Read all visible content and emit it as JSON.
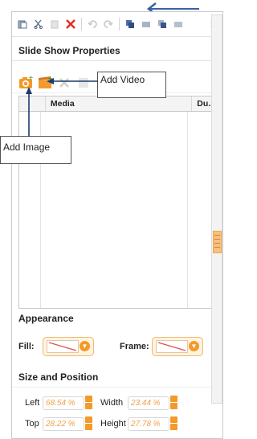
{
  "panel": {
    "title": "Slide Show Properties",
    "collapse_glyph": "»"
  },
  "table": {
    "columns": [
      "Media",
      "Du..."
    ]
  },
  "appearance": {
    "heading": "Appearance",
    "fill_label": "Fill:",
    "frame_label": "Frame:"
  },
  "size_position": {
    "heading": "Size and Position",
    "left_label": "Left",
    "left_value": "68.54 %",
    "width_label": "Width",
    "width_value": "23.44 %",
    "top_label": "Top",
    "top_value": "28.22 %",
    "height_label": "Height",
    "height_value": "27.78 %"
  },
  "annotations": {
    "add_video": "Add Video",
    "add_image": "Add Image"
  },
  "colors": {
    "accent": "#f39a2a",
    "annotation_arrow": "#3b5ea8",
    "callout_arrow": "#1a3c6e"
  }
}
